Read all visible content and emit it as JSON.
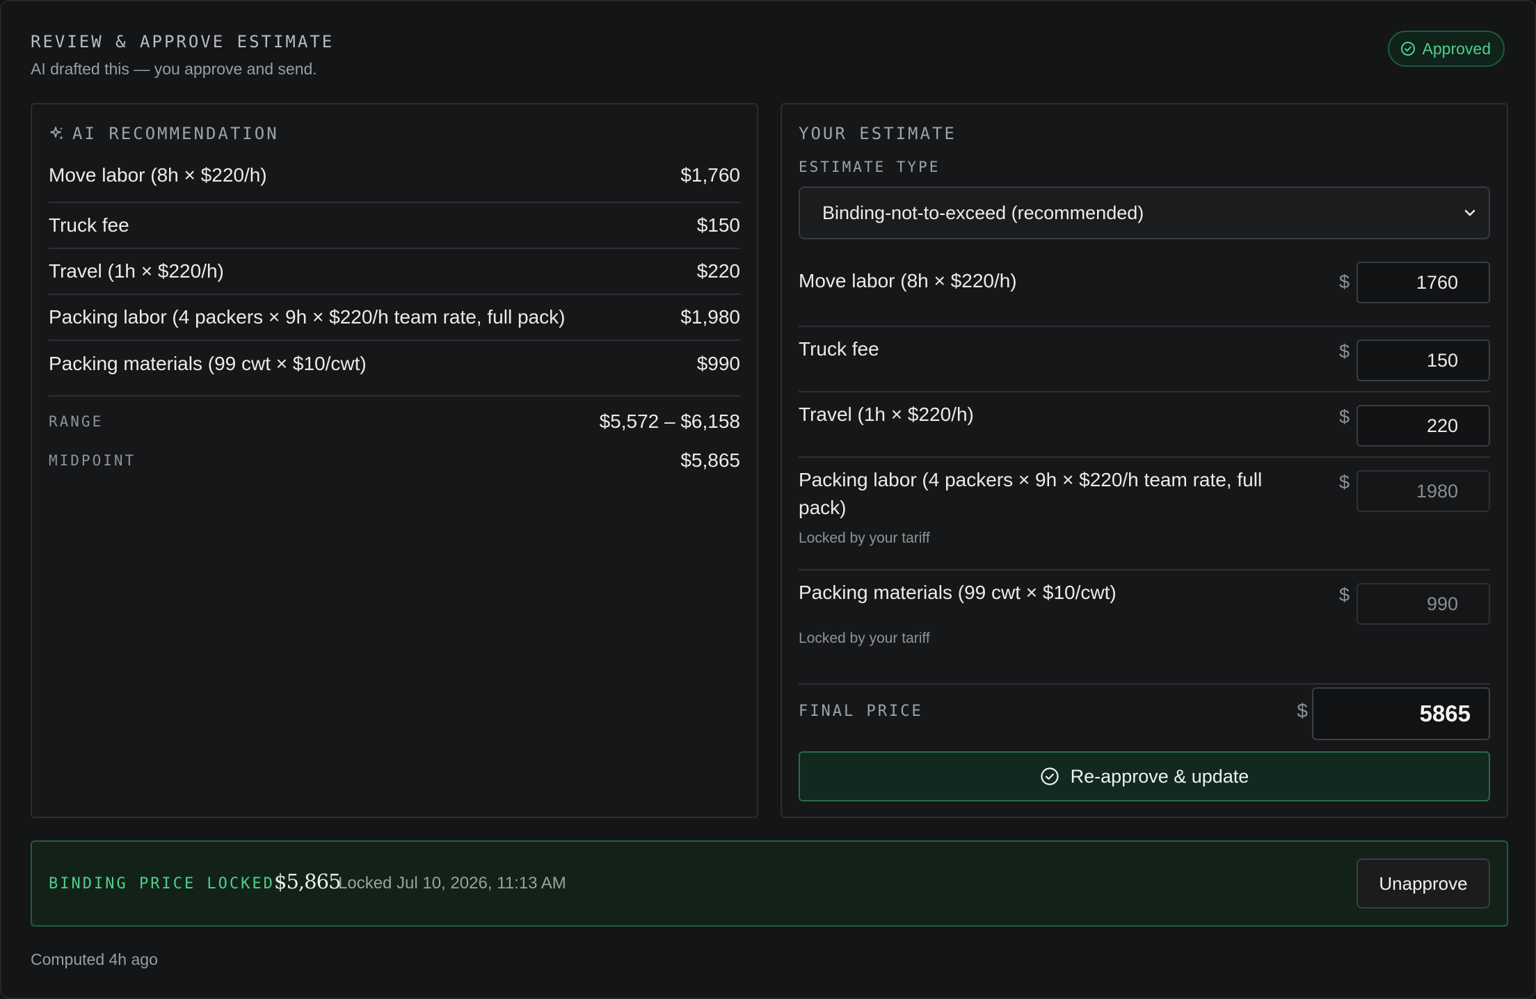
{
  "header": {
    "title": "REVIEW & APPROVE ESTIMATE",
    "subtitle": "AI drafted this — you approve and send.",
    "status_badge": "Approved"
  },
  "ai_recommendation": {
    "heading": "AI RECOMMENDATION",
    "items": [
      {
        "label": "Move labor (8h × $220/h)",
        "amount": "$1,760"
      },
      {
        "label": "Truck fee",
        "amount": "$150"
      },
      {
        "label": "Travel (1h × $220/h)",
        "amount": "$220"
      },
      {
        "label": "Packing labor (4 packers × 9h × $220/h team rate, full pack)",
        "amount": "$1,980"
      },
      {
        "label": "Packing materials (99 cwt × $10/cwt)",
        "amount": "$990"
      }
    ],
    "range_label": "RANGE",
    "range_value": "$5,572 – $6,158",
    "midpoint_label": "MIDPOINT",
    "midpoint_value": "$5,865"
  },
  "your_estimate": {
    "heading": "YOUR ESTIMATE",
    "type_label": "ESTIMATE TYPE",
    "type_value": "Binding-not-to-exceed (recommended)",
    "currency_symbol": "$",
    "items": [
      {
        "label": "Move labor (8h × $220/h)",
        "value": "1760",
        "locked": false,
        "note": ""
      },
      {
        "label": "Truck fee",
        "value": "150",
        "locked": false,
        "note": ""
      },
      {
        "label": "Travel (1h × $220/h)",
        "value": "220",
        "locked": false,
        "note": ""
      },
      {
        "label": "Packing labor (4 packers × 9h × $220/h team rate, full pack)",
        "value": "1980",
        "locked": true,
        "note": "Locked by your tariff"
      },
      {
        "label": "Packing materials (99 cwt × $10/cwt)",
        "value": "990",
        "locked": true,
        "note": "Locked by your tariff"
      }
    ],
    "final_price_label": "FINAL PRICE",
    "final_price_value": "5865",
    "reapprove_button": "Re-approve & update"
  },
  "lock_banner": {
    "label": "BINDING PRICE LOCKED",
    "price": "$5,865",
    "timestamp": "Locked Jul 10, 2026, 11:13 AM",
    "unapprove_button": "Unapprove"
  },
  "footer": {
    "computed": "Computed 4h ago"
  },
  "colors": {
    "accent_green": "#4fcf8c",
    "background": "#141516",
    "panel_border": "#2b2d30"
  },
  "icons": {
    "badge": "check-circle-icon",
    "ai_heading": "sparkle-icon",
    "select": "chevron-down-icon",
    "reapprove": "check-circle-icon"
  }
}
